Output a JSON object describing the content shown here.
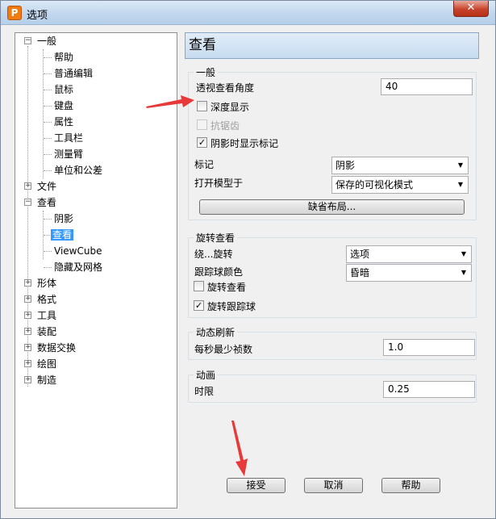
{
  "window": {
    "title": "选项",
    "app_icon_letter": "P",
    "close_label": "✕"
  },
  "tree": {
    "items": [
      {
        "label": "一般",
        "expander": "−"
      },
      {
        "label": "帮助"
      },
      {
        "label": "普通编辑"
      },
      {
        "label": "鼠标"
      },
      {
        "label": "键盘"
      },
      {
        "label": "属性"
      },
      {
        "label": "工具栏"
      },
      {
        "label": "测量臂"
      },
      {
        "label": "单位和公差"
      },
      {
        "label": "文件",
        "expander": "+"
      },
      {
        "label": "查看",
        "expander": "−"
      },
      {
        "label": "阴影"
      },
      {
        "label": "查看",
        "selected": true
      },
      {
        "label": "ViewCube"
      },
      {
        "label": "隐藏及网格"
      },
      {
        "label": "形体",
        "expander": "+"
      },
      {
        "label": "格式",
        "expander": "+"
      },
      {
        "label": "工具",
        "expander": "+"
      },
      {
        "label": "装配",
        "expander": "+"
      },
      {
        "label": "数据交换",
        "expander": "+"
      },
      {
        "label": "绘图",
        "expander": "+"
      },
      {
        "label": "制造",
        "expander": "+"
      }
    ]
  },
  "panel": {
    "title": "查看"
  },
  "general": {
    "title": "一般",
    "perspective_label": "透视查看角度",
    "perspective_value": "40",
    "depth_display_label": "深度显示",
    "depth_display_checked": false,
    "antialias_label": "抗锯齿",
    "antialias_checked": false,
    "antialias_enabled": false,
    "shadow_marker_label": "阴影时显示标记",
    "shadow_marker_checked": true,
    "marker_label": "标记",
    "marker_value": "阴影",
    "open_model_label": "打开模型于",
    "open_model_value": "保存的可视化模式",
    "default_layout_button": "缺省布局..."
  },
  "rotate": {
    "title": "旋转查看",
    "rotate_around_label": "绕...旋转",
    "rotate_around_value": "选项",
    "trackball_color_label": "跟踪球颜色",
    "trackball_color_value": "昏暗",
    "rotate_view_label": "旋转查看",
    "rotate_view_checked": false,
    "rotate_trackball_label": "旋转跟踪球",
    "rotate_trackball_checked": true
  },
  "refresh": {
    "title": "动态刷新",
    "fps_label": "每秒最少祯数",
    "fps_value": "1.0"
  },
  "animation": {
    "title": "动画",
    "duration_label": "时限",
    "duration_value": "0.25"
  },
  "buttons": {
    "accept": "接受",
    "cancel": "取消",
    "help": "帮助"
  },
  "annotations": {
    "arrow_color": "#e8393a"
  }
}
